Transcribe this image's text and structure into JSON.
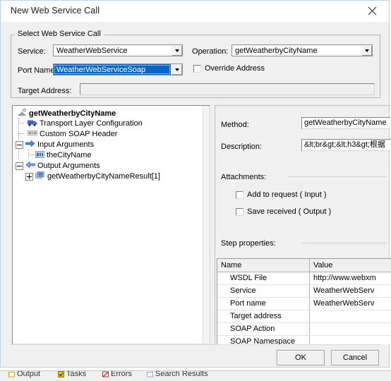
{
  "dialog": {
    "title": "New Web Service Call",
    "close_icon": "close-icon"
  },
  "groupbox": {
    "label": "Select Web Service Call",
    "service": {
      "label": "Service:",
      "value": "WeatherWebService"
    },
    "operation": {
      "label": "Operation:",
      "value": "getWeatherbyCityName"
    },
    "port_name": {
      "label": "Port Name:",
      "value": "WeatherWebServiceSoap",
      "selected": true,
      "selection_color": "#0a64c8"
    },
    "override_address": {
      "label": "Override Address",
      "checked": false
    },
    "target_address": {
      "label": "Target Address:",
      "value": ""
    }
  },
  "tree": {
    "nodes": [
      {
        "label": "getWeatherbyCityName",
        "icon": "webservice-icon",
        "bold": true,
        "depth": 0,
        "toggle": "none"
      },
      {
        "label": "Transport Layer Configuration",
        "icon": "transport-icon",
        "bold": false,
        "depth": 1,
        "toggle": "none"
      },
      {
        "label": "Custom SOAP Header",
        "icon": "soap-header-icon",
        "bold": false,
        "depth": 1,
        "toggle": "none"
      },
      {
        "label": "Input Arguments",
        "icon": "input-arrow-icon",
        "bold": false,
        "depth": 1,
        "toggle": "minus"
      },
      {
        "label": "theCityName",
        "icon": "string-argument-icon",
        "bold": false,
        "depth": 2,
        "toggle": "none"
      },
      {
        "label": "Output Arguments",
        "icon": "output-arrow-icon",
        "bold": false,
        "depth": 1,
        "toggle": "minus"
      },
      {
        "label": "getWeatherbyCityNameResult[1]",
        "icon": "array-argument-icon",
        "bold": false,
        "depth": 2,
        "toggle": "plus"
      }
    ]
  },
  "details": {
    "method": {
      "label": "Method:",
      "value": "getWeatherbyCityName"
    },
    "description": {
      "label": "Description:",
      "value": "&lt;br&gt;&lt;h3&gt;根据"
    },
    "attachments": {
      "label": "Attachments:",
      "add_to_request": {
        "label": "Add to request ( Input )",
        "checked": false
      },
      "save_received": {
        "label": "Save received ( Output )",
        "checked": false
      }
    },
    "step_properties": {
      "label": "Step properties:"
    }
  },
  "properties_grid": {
    "columns": [
      "Name",
      "Value"
    ],
    "rows": [
      {
        "name": "WSDL File",
        "value": "http://www.webxm"
      },
      {
        "name": "Service",
        "value": "WeatherWebServ"
      },
      {
        "name": "Port name",
        "value": "WeatherWebServ"
      },
      {
        "name": "Target address",
        "value": ""
      },
      {
        "name": "SOAP Action",
        "value": ""
      },
      {
        "name": "SOAP Namespace",
        "value": ""
      }
    ]
  },
  "footer": {
    "ok": "OK",
    "cancel": "Cancel"
  },
  "ide_status_tabs": [
    {
      "label": "Output",
      "icon": "output-icon"
    },
    {
      "label": "Tasks",
      "icon": "tasks-icon"
    },
    {
      "label": "Errors",
      "icon": "errors-icon"
    },
    {
      "label": "Search Results",
      "icon": "search-results-icon"
    }
  ]
}
